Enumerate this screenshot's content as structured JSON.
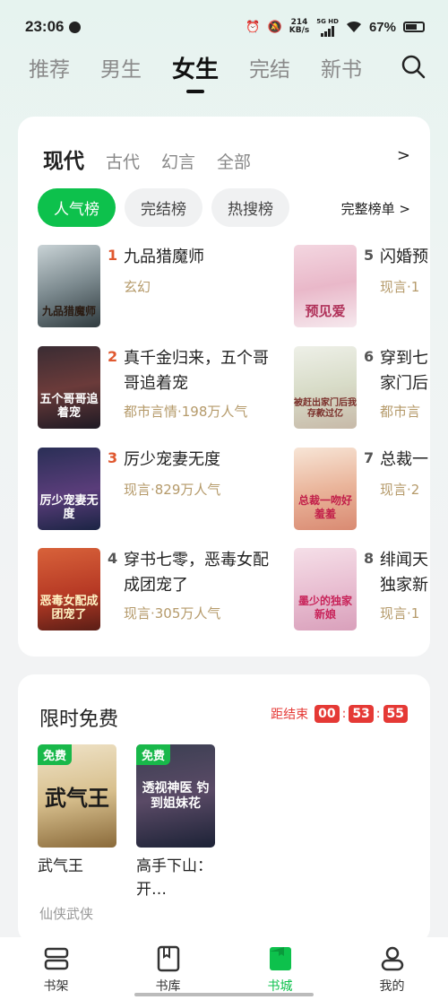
{
  "status": {
    "time": "23:06",
    "speed": "214",
    "speed_unit": "KB/s",
    "network": "5G HD",
    "battery": "67%"
  },
  "top_tabs": [
    "推荐",
    "男生",
    "女生",
    "完结",
    "新书"
  ],
  "categories": [
    "现代",
    "古代",
    "幻言",
    "全部"
  ],
  "category_more": ">",
  "chips": [
    "人气榜",
    "完结榜",
    "热搜榜"
  ],
  "full_rank_label": "完整榜单 >",
  "books": [
    {
      "rank": "1",
      "title": "九品猎魔师",
      "meta": "玄幻",
      "cover_text": "九品猎魔师",
      "rank_color": "#e0582f"
    },
    {
      "rank": "2",
      "title": "真千金归来，五个哥哥追着宠",
      "meta": "都市言情·198万人气",
      "cover_text": "五个哥哥追着宠",
      "rank_color": "#e0582f"
    },
    {
      "rank": "3",
      "title": "厉少宠妻无度",
      "meta": "现言·829万人气",
      "cover_text": "厉少宠妻无度",
      "rank_color": "#e0582f"
    },
    {
      "rank": "4",
      "title": "穿书七零，恶毒女配成团宠了",
      "meta": "现言·305万人气",
      "cover_text": "恶毒女配成团宠了",
      "rank_color": "#555555"
    },
    {
      "rank": "5",
      "title": "闪婚预",
      "meta": "现言·1",
      "cover_text": "预见爱",
      "rank_color": "#555555"
    },
    {
      "rank": "6",
      "title": "穿到七家门后",
      "meta": "都市言",
      "cover_text": "被赶出家门后我存款过亿",
      "rank_color": "#555555"
    },
    {
      "rank": "7",
      "title": "总裁一",
      "meta": "现言·2",
      "cover_text": "总裁一吻好羞羞",
      "rank_color": "#555555"
    },
    {
      "rank": "8",
      "title": "绯闻天独家新",
      "meta": "现言·1",
      "cover_text": "墨少的独家新娘",
      "rank_color": "#555555"
    }
  ],
  "free_section": {
    "title": "限时免费",
    "countdown_label": "距结束",
    "hours": "00",
    "minutes": "53",
    "seconds": "55",
    "badge": "免费",
    "books": [
      {
        "name": "武气王",
        "cover_text": "武气王"
      },
      {
        "name": "高手下山：开…",
        "cover_text": "透视神医 钓到姐妹花"
      }
    ],
    "genre": "仙侠武侠"
  },
  "nav": [
    "书架",
    "书库",
    "书城",
    "我的"
  ],
  "colors": {
    "accent": "#0dc14c",
    "rank_gold": "#b59a6a",
    "countdown": "#e53935"
  }
}
